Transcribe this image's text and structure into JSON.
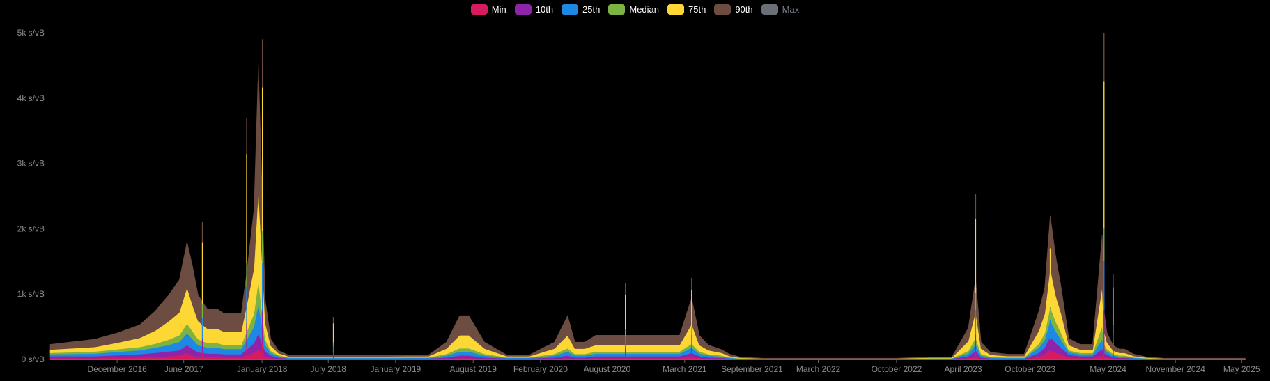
{
  "chart_data": {
    "type": "area",
    "stacked": true,
    "ylim": [
      0,
      5000
    ],
    "grid": false,
    "legend_placement": "top-center",
    "y_ticks": [
      {
        "value": 0,
        "label": "0 s/vB"
      },
      {
        "value": 1000,
        "label": "1k s/vB"
      },
      {
        "value": 2000,
        "label": "2k s/vB"
      },
      {
        "value": 3000,
        "label": "3k s/vB"
      },
      {
        "value": 4000,
        "label": "4k s/vB"
      },
      {
        "value": 5000,
        "label": "5k s/vB"
      }
    ],
    "x_range": [
      "2016-06-01",
      "2025-05-10"
    ],
    "x_ticks": [
      {
        "date": "2016-12-01",
        "label": "December 2016"
      },
      {
        "date": "2017-06-01",
        "label": "June 2017"
      },
      {
        "date": "2018-01-01",
        "label": "January 2018"
      },
      {
        "date": "2018-07-01",
        "label": "July 2018"
      },
      {
        "date": "2019-01-01",
        "label": "January 2019"
      },
      {
        "date": "2019-08-01",
        "label": "August 2019"
      },
      {
        "date": "2020-02-01",
        "label": "February 2020"
      },
      {
        "date": "2020-08-01",
        "label": "August 2020"
      },
      {
        "date": "2021-03-01",
        "label": "March 2021"
      },
      {
        "date": "2021-09-01",
        "label": "September 2021"
      },
      {
        "date": "2022-03-01",
        "label": "March 2022"
      },
      {
        "date": "2022-10-01",
        "label": "October 2022"
      },
      {
        "date": "2023-04-01",
        "label": "April 2023"
      },
      {
        "date": "2023-10-01",
        "label": "October 2023"
      },
      {
        "date": "2024-05-01",
        "label": "May 2024"
      },
      {
        "date": "2024-11-01",
        "label": "November 2024"
      },
      {
        "date": "2025-05-01",
        "label": "May 2025"
      }
    ],
    "legend": [
      {
        "key": "min",
        "name": "Min",
        "color": "#d81b60",
        "active": true
      },
      {
        "key": "p10",
        "name": "10th",
        "color": "#8e24aa",
        "active": true
      },
      {
        "key": "p25",
        "name": "25th",
        "color": "#1e88e5",
        "active": true
      },
      {
        "key": "median",
        "name": "Median",
        "color": "#7cb342",
        "active": true
      },
      {
        "key": "p75",
        "name": "75th",
        "color": "#fdd835",
        "active": true
      },
      {
        "key": "p90",
        "name": "90th",
        "color": "#6d4c41",
        "active": true
      },
      {
        "key": "max",
        "name": "Max",
        "color": "#6b6f78",
        "active": false
      }
    ],
    "stack_order": [
      "min",
      "p10",
      "p25",
      "median",
      "p75",
      "p90"
    ],
    "series_x": [
      "2016-06-01",
      "2016-08-01",
      "2016-10-01",
      "2016-12-01",
      "2017-02-01",
      "2017-03-15",
      "2017-04-20",
      "2017-05-20",
      "2017-06-10",
      "2017-06-25",
      "2017-07-10",
      "2017-07-22",
      "2017-08-05",
      "2017-09-01",
      "2017-09-20",
      "2017-10-15",
      "2017-11-05",
      "2017-11-20",
      "2017-12-10",
      "2017-12-22",
      "2018-01-10",
      "2018-01-25",
      "2018-02-15",
      "2018-03-15",
      "2018-05-01",
      "2018-06-01",
      "2018-06-20",
      "2018-08-01",
      "2018-10-01",
      "2018-12-01",
      "2019-02-01",
      "2019-04-01",
      "2019-05-20",
      "2019-06-25",
      "2019-07-20",
      "2019-09-01",
      "2019-11-01",
      "2020-01-01",
      "2020-03-10",
      "2020-04-15",
      "2020-05-05",
      "2020-06-01",
      "2020-07-01",
      "2020-08-01",
      "2020-09-01",
      "2020-09-20",
      "2020-10-15",
      "2020-11-15",
      "2020-12-15",
      "2021-01-15",
      "2021-02-15",
      "2021-03-20",
      "2021-04-10",
      "2021-05-05",
      "2021-06-10",
      "2021-07-01",
      "2021-08-01",
      "2021-10-01",
      "2022-01-01",
      "2022-04-01",
      "2022-07-01",
      "2022-10-01",
      "2023-01-01",
      "2023-03-01",
      "2023-04-15",
      "2023-05-05",
      "2023-05-20",
      "2023-06-15",
      "2023-08-01",
      "2023-09-15",
      "2023-10-25",
      "2023-11-10",
      "2023-11-25",
      "2023-12-10",
      "2023-12-25",
      "2024-01-15",
      "2024-02-15",
      "2024-03-20",
      "2024-04-15",
      "2024-04-20",
      "2024-04-28",
      "2024-05-15",
      "2024-06-01",
      "2024-06-15",
      "2024-07-10",
      "2024-08-15",
      "2024-10-01",
      "2024-12-01",
      "2025-02-01",
      "2025-05-10"
    ],
    "series": [
      {
        "key": "min",
        "name": "Min",
        "values": [
          20,
          20,
          20,
          25,
          30,
          40,
          50,
          60,
          100,
          60,
          40,
          40,
          35,
          35,
          30,
          30,
          30,
          60,
          100,
          150,
          40,
          20,
          10,
          5,
          5,
          5,
          5,
          5,
          5,
          5,
          5,
          5,
          10,
          20,
          20,
          10,
          5,
          5,
          10,
          20,
          10,
          10,
          20,
          20,
          20,
          20,
          20,
          20,
          20,
          20,
          20,
          40,
          20,
          10,
          10,
          5,
          3,
          2,
          2,
          2,
          2,
          2,
          5,
          5,
          20,
          50,
          10,
          5,
          5,
          5,
          40,
          80,
          150,
          100,
          80,
          30,
          20,
          20,
          60,
          40,
          30,
          15,
          10,
          10,
          5,
          5,
          2,
          2,
          2,
          2
        ]
      },
      {
        "key": "p10",
        "name": "10th",
        "values": [
          30,
          30,
          30,
          40,
          50,
          60,
          70,
          80,
          120,
          100,
          70,
          60,
          55,
          55,
          50,
          50,
          50,
          90,
          150,
          250,
          80,
          40,
          20,
          8,
          8,
          8,
          8,
          8,
          8,
          8,
          10,
          10,
          20,
          40,
          40,
          20,
          10,
          10,
          20,
          40,
          20,
          20,
          30,
          30,
          30,
          30,
          30,
          30,
          30,
          30,
          30,
          60,
          30,
          20,
          15,
          10,
          5,
          3,
          3,
          3,
          3,
          3,
          5,
          5,
          30,
          80,
          20,
          10,
          8,
          8,
          60,
          100,
          200,
          150,
          100,
          40,
          30,
          30,
          100,
          60,
          40,
          20,
          15,
          15,
          10,
          5,
          3,
          3,
          3,
          3
        ]
      },
      {
        "key": "p25",
        "name": "25th",
        "values": [
          30,
          35,
          40,
          50,
          60,
          80,
          100,
          130,
          180,
          150,
          110,
          100,
          90,
          90,
          80,
          80,
          80,
          150,
          250,
          450,
          100,
          40,
          20,
          10,
          10,
          10,
          10,
          10,
          10,
          10,
          10,
          10,
          30,
          60,
          60,
          30,
          10,
          10,
          30,
          60,
          30,
          30,
          40,
          40,
          40,
          40,
          40,
          40,
          40,
          40,
          40,
          80,
          40,
          30,
          20,
          10,
          5,
          3,
          3,
          3,
          3,
          3,
          5,
          5,
          40,
          100,
          30,
          15,
          10,
          10,
          80,
          120,
          250,
          180,
          120,
          40,
          30,
          30,
          150,
          80,
          50,
          30,
          20,
          20,
          10,
          5,
          3,
          3,
          3,
          3
        ]
      },
      {
        "key": "median",
        "name": "Median",
        "values": [
          20,
          25,
          30,
          40,
          50,
          60,
          80,
          100,
          150,
          120,
          90,
          80,
          70,
          70,
          60,
          60,
          60,
          120,
          200,
          350,
          80,
          30,
          15,
          8,
          8,
          8,
          8,
          8,
          8,
          8,
          8,
          8,
          25,
          50,
          50,
          25,
          8,
          8,
          25,
          50,
          25,
          25,
          30,
          30,
          30,
          30,
          30,
          30,
          30,
          30,
          30,
          60,
          30,
          20,
          15,
          8,
          4,
          2,
          2,
          2,
          2,
          2,
          4,
          4,
          40,
          100,
          25,
          10,
          8,
          8,
          60,
          100,
          200,
          150,
          100,
          30,
          20,
          20,
          200,
          60,
          40,
          20,
          15,
          15,
          8,
          4,
          2,
          2,
          2,
          2
        ]
      },
      {
        "key": "p75",
        "name": "75th",
        "values": [
          50,
          60,
          70,
          100,
          140,
          200,
          280,
          350,
          550,
          400,
          280,
          250,
          220,
          220,
          200,
          200,
          200,
          400,
          700,
          1400,
          250,
          80,
          30,
          15,
          15,
          15,
          15,
          15,
          15,
          15,
          15,
          15,
          80,
          200,
          200,
          80,
          15,
          15,
          80,
          200,
          80,
          80,
          100,
          100,
          100,
          100,
          100,
          100,
          100,
          100,
          100,
          300,
          100,
          60,
          40,
          20,
          8,
          4,
          4,
          4,
          4,
          4,
          8,
          8,
          150,
          400,
          80,
          30,
          20,
          20,
          200,
          300,
          600,
          400,
          300,
          80,
          50,
          50,
          600,
          200,
          100,
          50,
          40,
          40,
          20,
          8,
          4,
          4,
          4,
          4
        ]
      },
      {
        "key": "p90",
        "name": "90th",
        "values": [
          80,
          100,
          120,
          150,
          200,
          300,
          400,
          500,
          700,
          600,
          400,
          350,
          300,
          300,
          280,
          280,
          280,
          500,
          900,
          1900,
          350,
          100,
          40,
          20,
          20,
          20,
          20,
          20,
          20,
          20,
          20,
          20,
          100,
          300,
          300,
          100,
          20,
          20,
          100,
          300,
          100,
          100,
          150,
          150,
          150,
          150,
          150,
          150,
          150,
          150,
          150,
          400,
          150,
          80,
          50,
          30,
          10,
          6,
          6,
          6,
          6,
          6,
          10,
          10,
          200,
          500,
          100,
          40,
          30,
          30,
          300,
          400,
          800,
          600,
          400,
          100,
          80,
          80,
          800,
          300,
          150,
          80,
          60,
          60,
          30,
          10,
          6,
          6,
          6,
          6
        ]
      }
    ],
    "spikes": [
      {
        "date": "2017-07-22",
        "value": 2100
      },
      {
        "date": "2017-11-20",
        "value": 3700
      },
      {
        "date": "2018-01-02",
        "value": 4900
      },
      {
        "date": "2018-07-15",
        "value": 650
      },
      {
        "date": "2020-09-20",
        "value": 1170
      },
      {
        "date": "2021-03-20",
        "value": 1250
      },
      {
        "date": "2023-05-05",
        "value": 2530
      },
      {
        "date": "2023-11-25",
        "value": 2000
      },
      {
        "date": "2024-04-20",
        "value": 5000
      },
      {
        "date": "2024-05-15",
        "value": 1300
      }
    ]
  }
}
